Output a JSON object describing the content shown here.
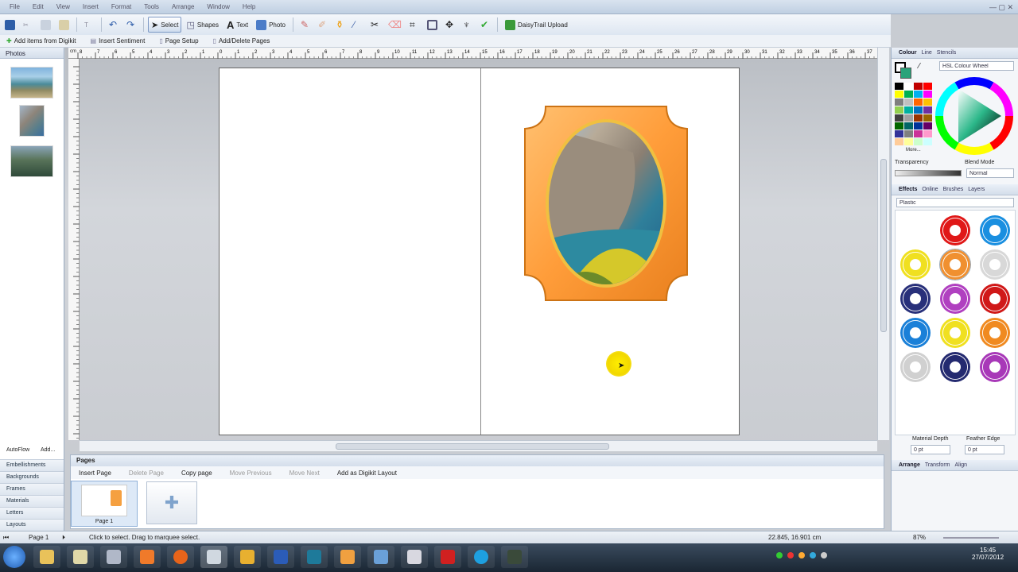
{
  "titlebar": {
    "menus": [
      "File",
      "Edit",
      "View",
      "Insert",
      "Format",
      "Tools",
      "Arrange",
      "Window",
      "Help"
    ]
  },
  "toolbar": {
    "select_label": "Select",
    "shapes_label": "Shapes",
    "text_label": "Text",
    "photo_label": "Photo",
    "upload_label": "DaisyTrail Upload"
  },
  "toolbar2": {
    "add_items": "Add items from Digikit",
    "insert_sentiment": "Insert Sentiment",
    "page_setup": "Page Setup",
    "add_delete_pages": "Add/Delete Pages"
  },
  "left": {
    "title": "Photos",
    "autoflow": "AutoFlow",
    "add": "Add...",
    "categories": [
      "Embellishments",
      "Backgrounds",
      "Frames",
      "Materials",
      "Letters",
      "Layouts"
    ]
  },
  "ruler": {
    "unit": "cm",
    "marks": [
      "8",
      "7",
      "6",
      "5",
      "4",
      "3",
      "2",
      "1",
      "0",
      "1",
      "2",
      "3",
      "4",
      "5",
      "6",
      "7",
      "8",
      "9",
      "10",
      "11",
      "12",
      "13",
      "14",
      "15",
      "16",
      "17",
      "18",
      "19",
      "20",
      "21",
      "22",
      "23",
      "24",
      "25",
      "26",
      "27",
      "28",
      "29",
      "30",
      "31",
      "32",
      "33",
      "34",
      "35",
      "36",
      "37"
    ]
  },
  "pages": {
    "title": "Pages",
    "insert": "Insert Page",
    "delete": "Delete Page",
    "copy": "Copy page",
    "move_prev": "Move Previous",
    "move_next": "Move Next",
    "add_layout": "Add as Digikit Layout",
    "page1_label": "Page 1"
  },
  "right": {
    "colour_tabs": [
      "Colour",
      "Line",
      "Stencils"
    ],
    "colour_model": "HSL Colour Wheel",
    "more": "More...",
    "transparency": "Transparency",
    "blend_mode": "Blend Mode",
    "blend_value": "Normal",
    "effects_tabs": [
      "Effects",
      "Online",
      "Brushes",
      "Layers"
    ],
    "effect_style": "Plastic",
    "material_depth": "Material Depth",
    "feather_edge": "Feather Edge",
    "depth_value": "0 pt",
    "feather_value": "0 pt",
    "arrange_tabs": [
      "Arrange",
      "Transform",
      "Align"
    ],
    "swatches": [
      "#000000",
      "#ffffff",
      "#c00000",
      "#ff0000",
      "#ffff00",
      "#00b050",
      "#00b0f0",
      "#ff00ff",
      "#7f7f7f",
      "#c0c0c0",
      "#ff6600",
      "#ffc000",
      "#92d050",
      "#00b0a0",
      "#0070c0",
      "#7030a0",
      "#404040",
      "#a0a0a0",
      "#993300",
      "#996600",
      "#006600",
      "#006666",
      "#003399",
      "#660066",
      "#333399",
      "#808080",
      "#cc3399",
      "#ff99cc",
      "#ffcc99",
      "#ffff99",
      "#ccffcc",
      "#ccffff"
    ],
    "gears": [
      "#ffffff",
      "#e01818",
      "#1a8fe0",
      "#f0e020",
      "#f09030",
      "#d8d8d8",
      "#28307a",
      "#b040c0",
      "#d01818",
      "#1a80d8",
      "#f0e020",
      "#f08a20",
      "#d0d0d0",
      "#242a70",
      "#a838b8"
    ]
  },
  "status": {
    "page": "Page 1",
    "hint": "Click to select. Drag to marquee select.",
    "coords": "22.845, 16.901 cm",
    "zoom": "87%"
  },
  "taskbar": {
    "time": "15:45",
    "date": "27/07/2012"
  }
}
